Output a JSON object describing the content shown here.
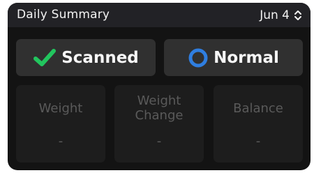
{
  "header": {
    "title": "Daily Summary",
    "date": "Jun 4"
  },
  "status": {
    "scanned": {
      "label": "Scanned",
      "icon": "checkmark-icon",
      "color": "#22c55e"
    },
    "normal": {
      "label": "Normal",
      "icon": "ring-icon",
      "color": "#2f7ee0"
    }
  },
  "metrics": [
    {
      "label": "Weight",
      "value": "-"
    },
    {
      "label": "Weight\nChange",
      "value": "-"
    },
    {
      "label": "Balance",
      "value": "-"
    }
  ],
  "colors": {
    "card_background": "#131313",
    "header_background": "#222226",
    "button_background": "#303030",
    "metric_background": "#1d1d1d",
    "muted_text": "#5a5a5a"
  }
}
